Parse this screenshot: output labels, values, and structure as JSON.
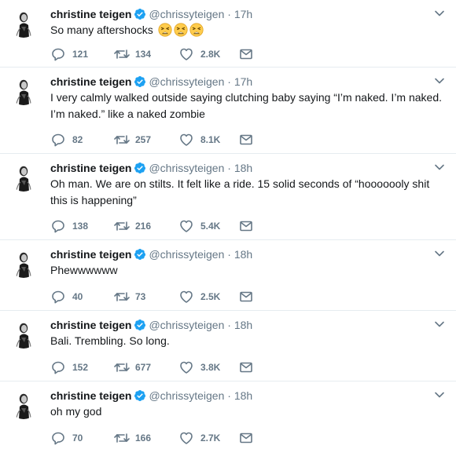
{
  "colors": {
    "text": "#14171a",
    "secondary": "#657786",
    "verified": "#1da1f2",
    "divider": "#e6ecf0"
  },
  "tweets": [
    {
      "name": "christine teigen",
      "handle": "@chrissyteigen",
      "dot": "·",
      "time": "17h",
      "text": "So many aftershocks",
      "emoji": [
        "tired-face-emoji",
        "tired-face-emoji",
        "tired-face-emoji"
      ],
      "replies": "121",
      "retweets": "134",
      "likes": "2.8K"
    },
    {
      "name": "christine teigen",
      "handle": "@chrissyteigen",
      "dot": "·",
      "time": "17h",
      "text": "I very calmly walked outside saying clutching baby saying “I’m naked. I’m naked. I’m naked.” like a naked zombie",
      "replies": "82",
      "retweets": "257",
      "likes": "8.1K"
    },
    {
      "name": "christine teigen",
      "handle": "@chrissyteigen",
      "dot": "·",
      "time": "18h",
      "text": "Oh man. We are on stilts. It felt like a ride. 15 solid seconds of “hooooooly shit this is happening”",
      "replies": "138",
      "retweets": "216",
      "likes": "5.4K"
    },
    {
      "name": "christine teigen",
      "handle": "@chrissyteigen",
      "dot": "·",
      "time": "18h",
      "text": "Phewwwwww",
      "replies": "40",
      "retweets": "73",
      "likes": "2.5K"
    },
    {
      "name": "christine teigen",
      "handle": "@chrissyteigen",
      "dot": "·",
      "time": "18h",
      "text": "Bali. Trembling. So long.",
      "replies": "152",
      "retweets": "677",
      "likes": "3.8K"
    },
    {
      "name": "christine teigen",
      "handle": "@chrissyteigen",
      "dot": "·",
      "time": "18h",
      "text": "oh my god",
      "replies": "70",
      "retweets": "166",
      "likes": "2.7K"
    }
  ]
}
